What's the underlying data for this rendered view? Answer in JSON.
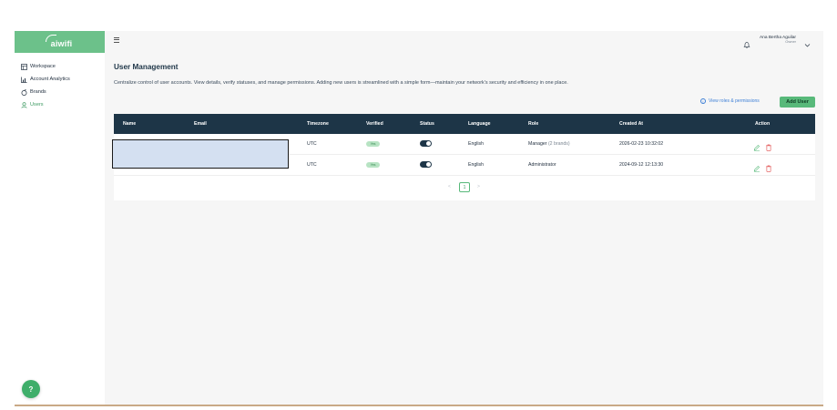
{
  "brand": {
    "logo_text": "aiwifi",
    "accent": "#6cc18a",
    "header_bg": "#1d3547"
  },
  "sidebar": {
    "items": [
      {
        "label": "Workspace",
        "icon": "workspace-icon"
      },
      {
        "label": "Account Analytics",
        "icon": "analytics-icon"
      },
      {
        "label": "Brands",
        "icon": "brands-icon"
      },
      {
        "label": "Users",
        "icon": "user-icon",
        "active": true
      }
    ],
    "help_label": "?"
  },
  "topbar": {
    "user_name": "Ana Bertha Aguilar",
    "user_role": "Owner"
  },
  "page": {
    "title": "User Management",
    "description": "Centralize control of user accounts. View details, verify statuses, and manage permissions. Adding new users is streamlined with a simple form—maintain your network's security and efficiency in one place.",
    "roles_link": "View roles & permissions",
    "add_user": "Add User"
  },
  "table": {
    "columns": [
      "Name",
      "Email",
      "Timezone",
      "Verified",
      "Status",
      "Language",
      "Role",
      "Created At",
      "Action"
    ],
    "rows": [
      {
        "timezone": "UTC",
        "verified": "Yes",
        "status_on": true,
        "language": "English",
        "role": "Manager",
        "role_extra": "(2 brands)",
        "created_at": "2026-02-23 10:32:02"
      },
      {
        "timezone": "UTC",
        "verified": "Yes",
        "status_on": true,
        "language": "English",
        "role": "Administrator",
        "role_extra": "",
        "created_at": "2024-09-12 12:13:30"
      }
    ]
  },
  "pagination": {
    "prev": "<",
    "current": "1",
    "next": ">"
  }
}
